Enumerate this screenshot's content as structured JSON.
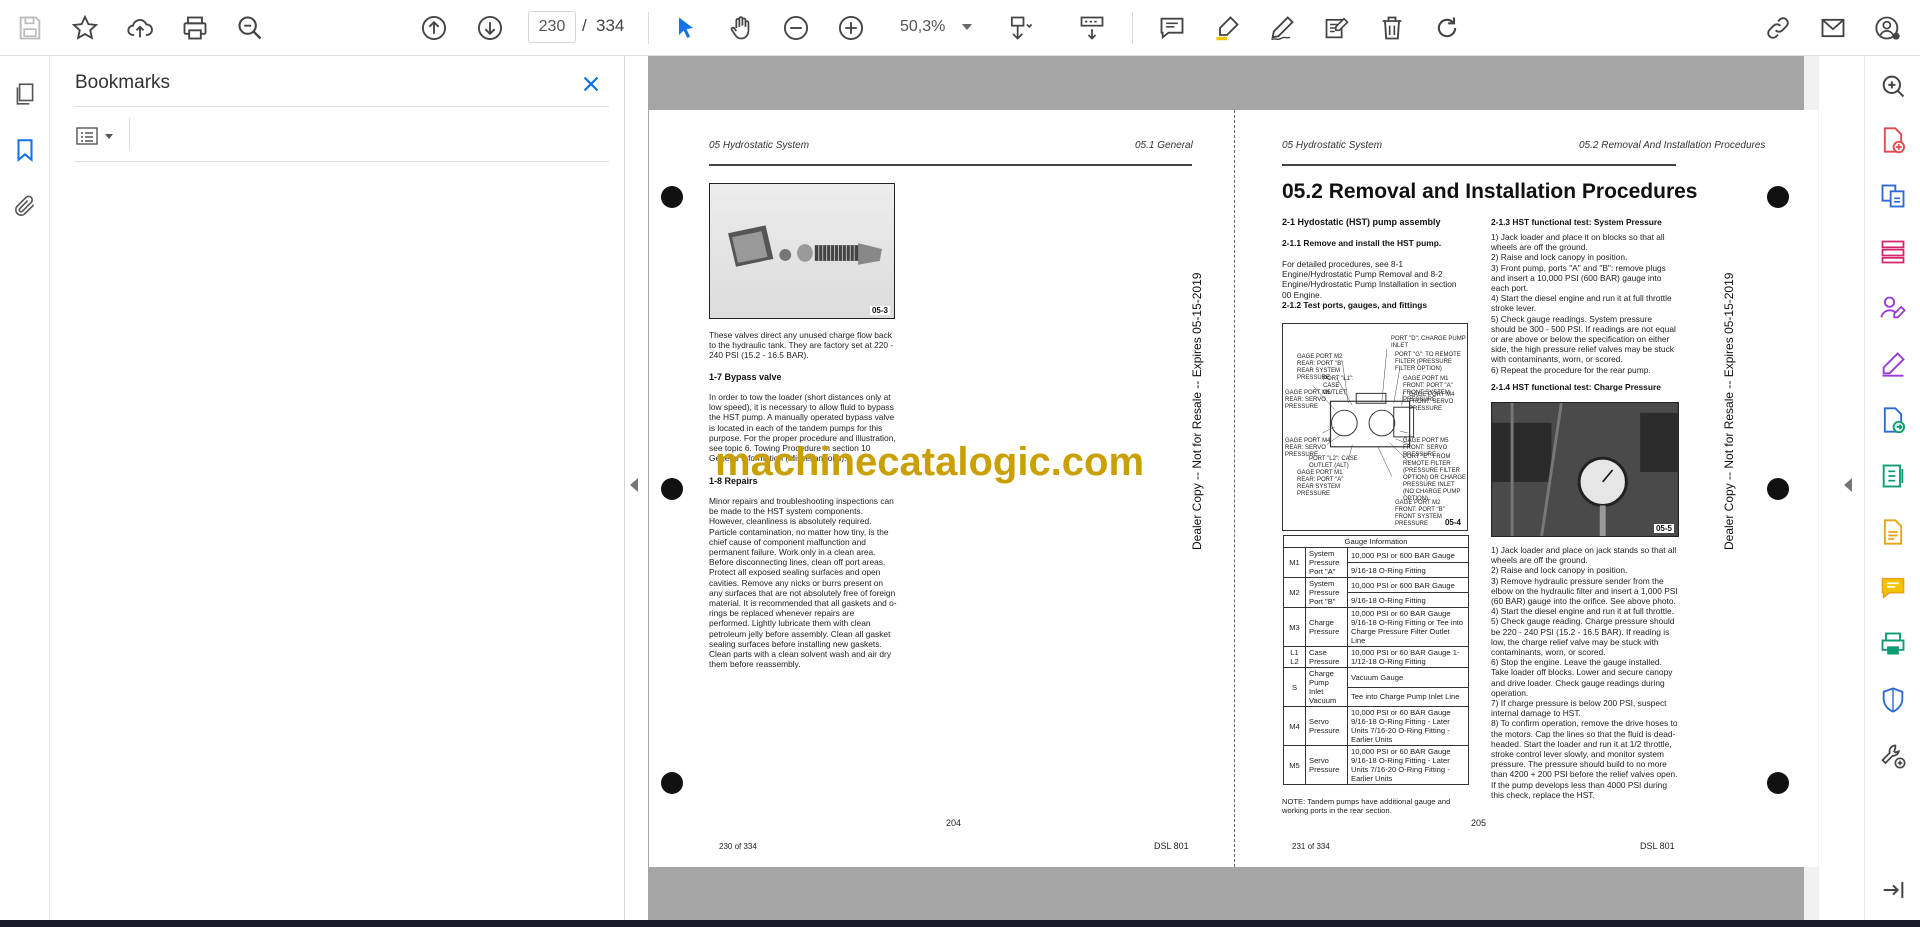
{
  "toolbar": {
    "page_current": "230",
    "page_separator": "/",
    "page_total": "334",
    "zoom_value": "50,3%"
  },
  "bookmarks_panel": {
    "title": "Bookmarks"
  },
  "document": {
    "watermark": "machinecatalogic.com",
    "left_page": {
      "header_left": "05 Hydrostatic System",
      "header_right": "05.1 General",
      "photo_label": "05-3",
      "para1": "These valves direct any unused charge flow back to the hydraulic tank. They are factory set at 220 - 240 PSI (15.2 - 16.5 BAR).",
      "section_bypass": "1-7 Bypass valve",
      "para_bypass": "In order to tow the loader (short distances only at low speed), it is necessary to allow fluid to bypass the HST pump. A manually operated bypass valve is located in each of the tandem pumps for this purpose. For the proper procedure and illustration, see topic 6. Towing Procedure in section 10 General Information (Miscellaneous).",
      "section_repairs": "1-8 Repairs",
      "para_repairs": "Minor repairs and troubleshooting inspections can be made to the HST system components. However, cleanliness is absolutely required. Particle contamination, no matter how tiny, is the chief cause of component malfunction and permanent failure. Work only in a clean area. Before disconnecting lines, clean off port areas. Protect all exposed sealing surfaces and open cavities. Remove any nicks or burrs present on any surfaces that are not absolutely free of foreign material. It is recommended that all gaskets and o-rings be replaced whenever repairs are performed. Lightly lubricate them with clean petroleum jelly before assembly. Clean all gasket sealing surfaces before installing new gaskets. Clean parts with a clean solvent wash and air dry them before reassembly.",
      "page_number": "204",
      "footer_left": "230 of 334",
      "footer_right": "DSL 801",
      "side_text": "Dealer Copy -- Not for Resale -- Expires 05-15-2019"
    },
    "right_page": {
      "header_left": "05 Hydrostatic System",
      "header_right": "05.2 Removal And Installation Procedures",
      "title": "05.2 Removal and Installation Procedures",
      "s21": "2-1 Hydostatic (HST) pump assembly",
      "s211": "2-1.1 Remove and install the HST pump.",
      "p211": "For detailed procedures, see 8-1 Engine/Hydrostatic Pump Removal and 8-2 Engine/Hydrostatic Pump Installation in section 00 Engine.",
      "s212": "2-1.2 Test ports, gauges, and fittings",
      "diagram_label": "05-4",
      "diagram_callouts": [
        "PORT \"D\": CHARGE PUMP INLET",
        "PORT \"G\": TO REMOTE FILTER (PRESSURE FILTER OPTION)",
        "GAGE PORT M2 REAR: PORT \"B\" REAR SYSTEM PRESSURE",
        "PORT \"L1\": CASE OUTLET",
        "GAGE PORT M5 REAR: SERVO PRESSURE",
        "GAGE PORT M1 FRONT: PORT \"A\" FRONT SYSTEM PRESSURE",
        "GAGE PORT M4 FRONT: SERVO PRESSURE",
        "GAGE PORT M4 REAR: SERVO PRESSURE",
        "PORT \"L2\": CASE OUTLET (ALT)",
        "GAGE PORT M1 REAR: PORT \"A\" REAR SYSTEM PRESSURE",
        "GAGE PORT M5 FRONT: SERVO PRESSURE",
        "PORT \"E\": FROM REMOTE FILTER (PRESSURE FILTER OPTION) OR CHARGE PRESSURE INLET (NO CHARGE PUMP OPTION)",
        "GAGE PORT M2 FRONT: PORT \"B\" FRONT SYSTEM PRESSURE"
      ],
      "table_title": "Gauge Information",
      "table_rows": [
        {
          "id": "M1",
          "name": "System Pressure Port \"A\"",
          "specs": [
            "10,000 PSI or 600 BAR Gauge",
            "9/16-18 O-Ring Fitting"
          ]
        },
        {
          "id": "M2",
          "name": "System Pressure Port \"B\"",
          "specs": [
            "10,000 PSI or 600 BAR Gauge",
            "9/16-18 O-Ring Fitting"
          ]
        },
        {
          "id": "M3",
          "name": "Charge Pressure",
          "specs": [
            "10,000 PSI or 60 BAR Gauge 9/16-18 O-Ring Fitting or Tee into Charge Pressure Filter Outlet Line"
          ]
        },
        {
          "id": "L1 L2",
          "name": "Case Pressure",
          "specs": [
            "10,000 PSI or 60 BAR Gauge 1-1/12-18 O-Ring Fitting"
          ]
        },
        {
          "id": "S",
          "name": "Charge Pump Inlet Vacuum",
          "specs": [
            "Vacuum Gauge",
            "Tee into Charge Pump Inlet Line"
          ]
        },
        {
          "id": "M4",
          "name": "Servo Pressure",
          "specs": [
            "10,000 PSI or 60 BAR Gauge 9/16-18 O-Ring Fitting - Later Units 7/16-20 O-Ring Fitting - Earlier Units"
          ]
        },
        {
          "id": "M5",
          "name": "Servo Pressure",
          "specs": [
            "10,000 PSI or 60 BAR Gauge 9/16-18 O-Ring Fitting - Later Units 7/16-20 O-Ring Fitting - Earlier Units"
          ]
        }
      ],
      "table_note": "NOTE: Tandem pumps have additional gauge and working ports in the rear section.",
      "s213": "2-1.3 HST functional test: System Pressure",
      "steps213": [
        "1) Jack loader and place it on blocks so that all wheels are off the ground.",
        "2) Raise and lock canopy in position.",
        "3) Front pump, ports \"A\" and \"B\": remove plugs and insert a 10,000 PSI (600 BAR) gauge into each port.",
        "4) Start the diesel engine and run it at full throttle stroke lever.",
        "5) Check gauge readings. System pressure should be 300 - 500 PSI. If readings are not equal or are above or below the specification on either side, the high pressure relief valves may be stuck with contaminants, worn, or scored.",
        "6) Repeat the procedure for the rear pump."
      ],
      "s214": "2-1.4 HST functional test: Charge Pressure",
      "photo_label": "05-5",
      "steps214": [
        "1) Jack loader and place on jack stands so that all wheels are off the ground.",
        "2) Raise and lock canopy in position.",
        "3) Remove hydraulic pressure sender from the elbow on the hydraulic filter and insert a 1,000 PSI (60 BAR) gauge into the orifice. See above photo.",
        "4) Start the diesel engine and run it at full throttle.",
        "5) Check gauge reading. Charge pressure should be 220 - 240 PSI (15.2 - 16.5 BAR). If reading is low, the charge relief valve may be stuck with contaminants, worn, or scored.",
        "6) Stop the engine. Leave the gauge installed. Take loader off blocks. Lower and secure canopy and drive loader. Check gauge readings during operation.",
        "7) If charge pressure is below 200 PSI, suspect internal damage to HST.",
        "8) To confirm operation, remove the drive hoses to the motors. Cap the lines so that the fluid is dead-headed. Start the loader and run it at 1/2 throttle, stroke control lever slowly, and monitor system pressure. The pressure should build to no more than 4200 + 200 PSI before the relief valves open. If the pump develops less than 4000 PSI during this check, replace the HST."
      ],
      "page_number": "205",
      "footer_left": "231 of 334",
      "footer_right": "DSL 801",
      "side_text": "Dealer Copy -- Not for Resale -- Expires 05-15-2019"
    }
  }
}
